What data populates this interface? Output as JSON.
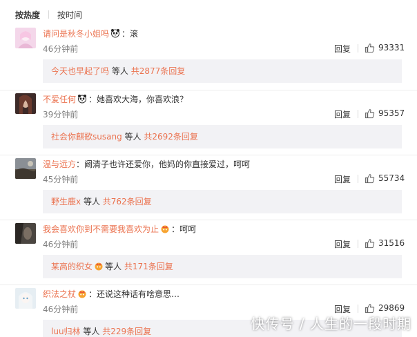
{
  "sort_tabs": {
    "hot": "按热度",
    "time": "按时间"
  },
  "labels": {
    "reply": "回复",
    "colon": "：",
    "etc": "等人"
  },
  "colors": {
    "link": "#eb7350",
    "text": "#333333",
    "meta": "#808080",
    "reply_bg": "#f2f2f5"
  },
  "comments": [
    {
      "user": "请问是秋冬小姐吗",
      "user_icon": "panda-emoji-icon",
      "text": "滚",
      "time": "46分钟前",
      "likes": "93331",
      "reply_user": "今天也早起了吗",
      "reply_user_icon": "",
      "reply_total": "共2877条回复"
    },
    {
      "user": "不爱任何",
      "user_icon": "panda-emoji-icon",
      "text": "她喜欢大海，你喜欢浪？",
      "time": "39分钟前",
      "likes": "95357",
      "reply_user": "社会你麒歌susang",
      "reply_user_icon": "",
      "reply_total": "共2692条回复"
    },
    {
      "user": "温与远方",
      "user_icon": "",
      "text": "阚清子也许还爱你，他妈的你直接爱过，呵呵",
      "time": "45分钟前",
      "likes": "55734",
      "reply_user": "野生鹿x",
      "reply_user_icon": "",
      "reply_total": "共762条回复"
    },
    {
      "user": "我会喜欢你到不需要我喜欢为止",
      "user_icon": "vip-crown-badge-icon",
      "text": "呵呵",
      "time": "46分钟前",
      "likes": "31516",
      "reply_user": "某高的织女",
      "reply_user_icon": "vip-crown-badge-icon",
      "reply_total": "共171条回复"
    },
    {
      "user": "织法之杖",
      "user_icon": "vip-crown-badge-icon",
      "text": "还说这种话有啥意思…",
      "time": "46分钟前",
      "likes": "29869",
      "reply_user": "luu归林",
      "reply_user_icon": "",
      "reply_total": "共229条回复"
    }
  ],
  "watermark": "快传号 / 人生的一段时期"
}
